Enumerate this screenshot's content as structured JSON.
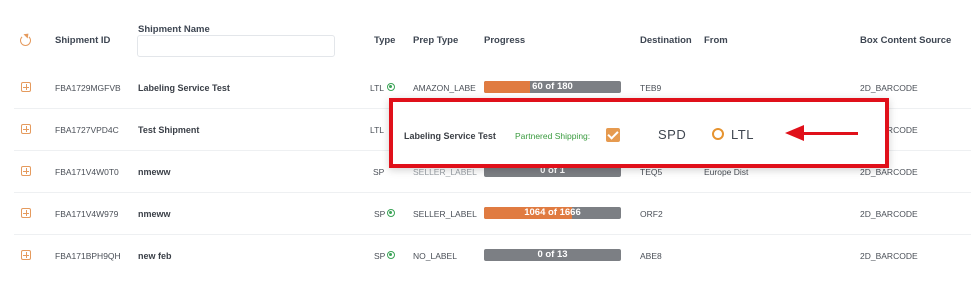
{
  "header": {
    "shipment_id": "Shipment ID",
    "shipment_name": "Shipment Name",
    "type": "Type",
    "prep_type": "Prep Type",
    "progress": "Progress",
    "destination": "Destination",
    "from": "From",
    "box_content_source": "Box Content Source",
    "name_filter_value": ""
  },
  "rows": [
    {
      "id": "FBA1729MGFVB",
      "name": "Labeling Service Test",
      "type": "LTL",
      "prep": "AMAZON_LABE",
      "progress_text": "60 of 180",
      "progress_fraction": 0.333,
      "destination": "TEB9",
      "from": "",
      "box_source": "2D_BARCODE"
    },
    {
      "id": "FBA1727VPD4C",
      "name": "Test Shipment",
      "type": "LTL",
      "prep": "",
      "progress_text": "",
      "progress_fraction": 0,
      "destination": "",
      "from": "",
      "box_source": "2D_BARCODE"
    },
    {
      "id": "FBA171V4W0T0",
      "name": "nmeww",
      "type": "SP",
      "prep": "SELLER_LABEL",
      "progress_text": "0 of 1",
      "progress_fraction": 0,
      "destination": "TEQ5",
      "from": "Europe Dist",
      "box_source": "2D_BARCODE"
    },
    {
      "id": "FBA171V4W979",
      "name": "nmeww",
      "type": "SP",
      "prep": "SELLER_LABEL",
      "progress_text": "1064 of 1666",
      "progress_fraction": 0.639,
      "destination": "ORF2",
      "from": "",
      "box_source": "2D_BARCODE"
    },
    {
      "id": "FBA171BPH9QH",
      "name": "new feb",
      "type": "SP",
      "prep": "NO_LABEL",
      "progress_text": "0 of 13",
      "progress_fraction": 0,
      "destination": "ABE8",
      "from": "",
      "box_source": "2D_BARCODE"
    }
  ],
  "popup": {
    "shipment_name": "Labeling Service Test",
    "partnered_label": "Partnered Shipping:",
    "partnered_checked": true,
    "option_spd": "SPD",
    "option_ltl": "LTL",
    "selected_option": "LTL",
    "highlight_color": "#e0101a"
  },
  "colors": {
    "accent": "#e07b41",
    "progress_track": "#7c7f84",
    "type_icon": "#3aa356"
  }
}
